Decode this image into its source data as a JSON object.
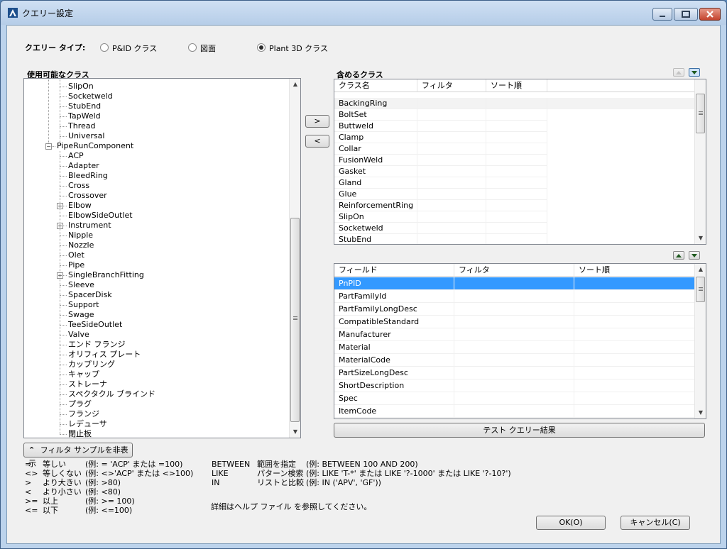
{
  "window": {
    "title": "クエリー設定"
  },
  "query_type": {
    "label": "クエリー タイプ:",
    "options": [
      "P&ID クラス",
      "図面",
      "Plant 3D クラス"
    ],
    "selected": "Plant 3D クラス"
  },
  "available": {
    "heading": "使用可能なクラス",
    "items": [
      {
        "label": "SlipOn",
        "level": 2,
        "expander": false
      },
      {
        "label": "Socketweld",
        "level": 2,
        "expander": false
      },
      {
        "label": "StubEnd",
        "level": 2,
        "expander": false
      },
      {
        "label": "TapWeld",
        "level": 2,
        "expander": false
      },
      {
        "label": "Thread",
        "level": 2,
        "expander": false
      },
      {
        "label": "Universal",
        "level": 2,
        "expander": false
      },
      {
        "label": "PipeRunComponent",
        "level": 1,
        "expander": "minus"
      },
      {
        "label": "ACP",
        "level": 2,
        "expander": false
      },
      {
        "label": "Adapter",
        "level": 2,
        "expander": false
      },
      {
        "label": "BleedRing",
        "level": 2,
        "expander": false
      },
      {
        "label": "Cross",
        "level": 2,
        "expander": false
      },
      {
        "label": "Crossover",
        "level": 2,
        "expander": false
      },
      {
        "label": "Elbow",
        "level": 2,
        "expander": "plus"
      },
      {
        "label": "ElbowSideOutlet",
        "level": 2,
        "expander": false
      },
      {
        "label": "Instrument",
        "level": 2,
        "expander": "plus"
      },
      {
        "label": "Nipple",
        "level": 2,
        "expander": false
      },
      {
        "label": "Nozzle",
        "level": 2,
        "expander": false
      },
      {
        "label": "Olet",
        "level": 2,
        "expander": false
      },
      {
        "label": "Pipe",
        "level": 2,
        "expander": false
      },
      {
        "label": "SingleBranchFitting",
        "level": 2,
        "expander": "plus"
      },
      {
        "label": "Sleeve",
        "level": 2,
        "expander": false
      },
      {
        "label": "SpacerDisk",
        "level": 2,
        "expander": false
      },
      {
        "label": "Support",
        "level": 2,
        "expander": false
      },
      {
        "label": "Swage",
        "level": 2,
        "expander": false
      },
      {
        "label": "TeeSideOutlet",
        "level": 2,
        "expander": false
      },
      {
        "label": "Valve",
        "level": 2,
        "expander": false
      },
      {
        "label": "エンド フランジ",
        "level": 2,
        "expander": false
      },
      {
        "label": "オリフィス プレート",
        "level": 2,
        "expander": false
      },
      {
        "label": "カップリング",
        "level": 2,
        "expander": false
      },
      {
        "label": "キャップ",
        "level": 2,
        "expander": false
      },
      {
        "label": "ストレーナ",
        "level": 2,
        "expander": false
      },
      {
        "label": "スペクタクル ブラインド",
        "level": 2,
        "expander": false
      },
      {
        "label": "プラグ",
        "level": 2,
        "expander": false
      },
      {
        "label": "フランジ",
        "level": 2,
        "expander": false
      },
      {
        "label": "レデューサ",
        "level": 2,
        "expander": false
      },
      {
        "label": "閉止板",
        "level": 2,
        "expander": false
      }
    ]
  },
  "move": {
    "add": ">",
    "remove": "<"
  },
  "included": {
    "heading": "含めるクラス",
    "columns": [
      "クラス名",
      "フィルタ",
      "ソート順"
    ],
    "rows": [
      "BackingRing",
      "BoltSet",
      "Buttweld",
      "Clamp",
      "Collar",
      "FusionWeld",
      "Gasket",
      "Gland",
      "Glue",
      "ReinforcementRing",
      "SlipOn",
      "Socketweld",
      "StubEnd"
    ]
  },
  "fields": {
    "columns": [
      "フィールド",
      "フィルタ",
      "ソート順"
    ],
    "rows": [
      "PnPID",
      "PartFamilyId",
      "PartFamilyLongDesc",
      "CompatibleStandard",
      "Manufacturer",
      "Material",
      "MaterialCode",
      "PartSizeLongDesc",
      "ShortDescription",
      "Spec",
      "ItemCode"
    ],
    "selected": "PnPID"
  },
  "test_button": "テスト クエリー結果",
  "toggle_filter": "フィルタ サンプルを非表示",
  "help": {
    "operators": [
      {
        "op": "=",
        "name": "等しい",
        "ex": "(例: = 'ACP' または =100)"
      },
      {
        "op": "<>",
        "name": "等しくない",
        "ex": "(例: <>'ACP' または <>100)"
      },
      {
        "op": ">",
        "name": "より大きい",
        "ex": "(例: >80)"
      },
      {
        "op": "<",
        "name": "より小さい",
        "ex": "(例: <80)"
      },
      {
        "op": ">=",
        "name": "以上",
        "ex": "(例: >= 100)"
      },
      {
        "op": "<=",
        "name": "以下",
        "ex": "(例: <=100)"
      }
    ],
    "keywords": [
      {
        "kw": "BETWEEN",
        "name": "範囲を指定",
        "ex": "(例: BETWEEN 100 AND 200)"
      },
      {
        "kw": "LIKE",
        "name": "パターン検索",
        "ex": "(例: LIKE 'T-*' または LIKE '?-1000' または LIKE '?-10?')"
      },
      {
        "kw": "IN",
        "name": "リストと比較",
        "ex": "(例: IN ('APV', 'GF'))"
      }
    ],
    "note": "詳細はヘルプ ファイル を参照してください。"
  },
  "ok_button": "OK(O)",
  "cancel_button": "キャンセル(C)",
  "colors": {
    "selection": "#3399ff",
    "frame": "#bcd3ec",
    "client": "#f0f0f0"
  }
}
